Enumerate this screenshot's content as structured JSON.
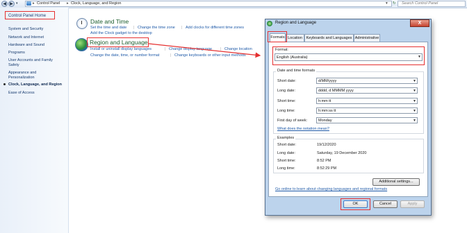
{
  "address_bar": {
    "crumbs": [
      "Control Panel",
      "Clock, Language, and Region"
    ],
    "search_placeholder": "Search Control Panel"
  },
  "left_nav": {
    "home": "Control Panel Home",
    "items": [
      "System and Security",
      "Network and Internet",
      "Hardware and Sound",
      "Programs",
      "User Accounts and Family Safety",
      "Appearance and Personalization",
      "Clock, Language, and Region",
      "Ease of Access"
    ],
    "current_index": 6
  },
  "sections": {
    "date_time": {
      "title": "Date and Time",
      "links": [
        "Set the time and date",
        "Change the time zone",
        "Add clocks for different time zones",
        "Add the Clock gadget to the desktop"
      ]
    },
    "region_language": {
      "title": "Region and Language",
      "links": [
        "Install or uninstall display languages",
        "Change display language",
        "Change location",
        "Change the date, time, or number format",
        "Change keyboards or other input methods"
      ]
    }
  },
  "dialog": {
    "title": "Region and Language",
    "close_glyph": "X",
    "tabs": [
      "Formats",
      "Location",
      "Keyboards and Languages",
      "Administrative"
    ],
    "active_tab": "Formats",
    "format_label": "Format:",
    "format_value": "English (Australia)",
    "dt_group_label": "Date and time formats",
    "fields": [
      {
        "label": "Short date:",
        "value": "d/MM/yyyy"
      },
      {
        "label": "Long date:",
        "value": "dddd, d MMMM yyyy"
      },
      {
        "label": "Short time:",
        "value": "h:mm tt"
      },
      {
        "label": "Long time:",
        "value": "h:mm:ss tt"
      },
      {
        "label": "First day of week:",
        "value": "Monday"
      }
    ],
    "notation_link": "What does the notation mean?",
    "examples_label": "Examples",
    "examples": [
      {
        "label": "Short date:",
        "value": "19/12/2020"
      },
      {
        "label": "Long date:",
        "value": "Saturday, 19 December 2020"
      },
      {
        "label": "Short time:",
        "value": "8:52 PM"
      },
      {
        "label": "Long time:",
        "value": "8:52:29 PM"
      }
    ],
    "additional_settings": "Additional settings...",
    "online_link": "Go online to learn about changing languages and regional formats",
    "buttons": {
      "ok": "OK",
      "cancel": "Cancel",
      "apply": "Apply"
    }
  },
  "colors": {
    "highlight": "#e53030",
    "link": "#1f5aa8",
    "heading": "#1c5e2e"
  }
}
